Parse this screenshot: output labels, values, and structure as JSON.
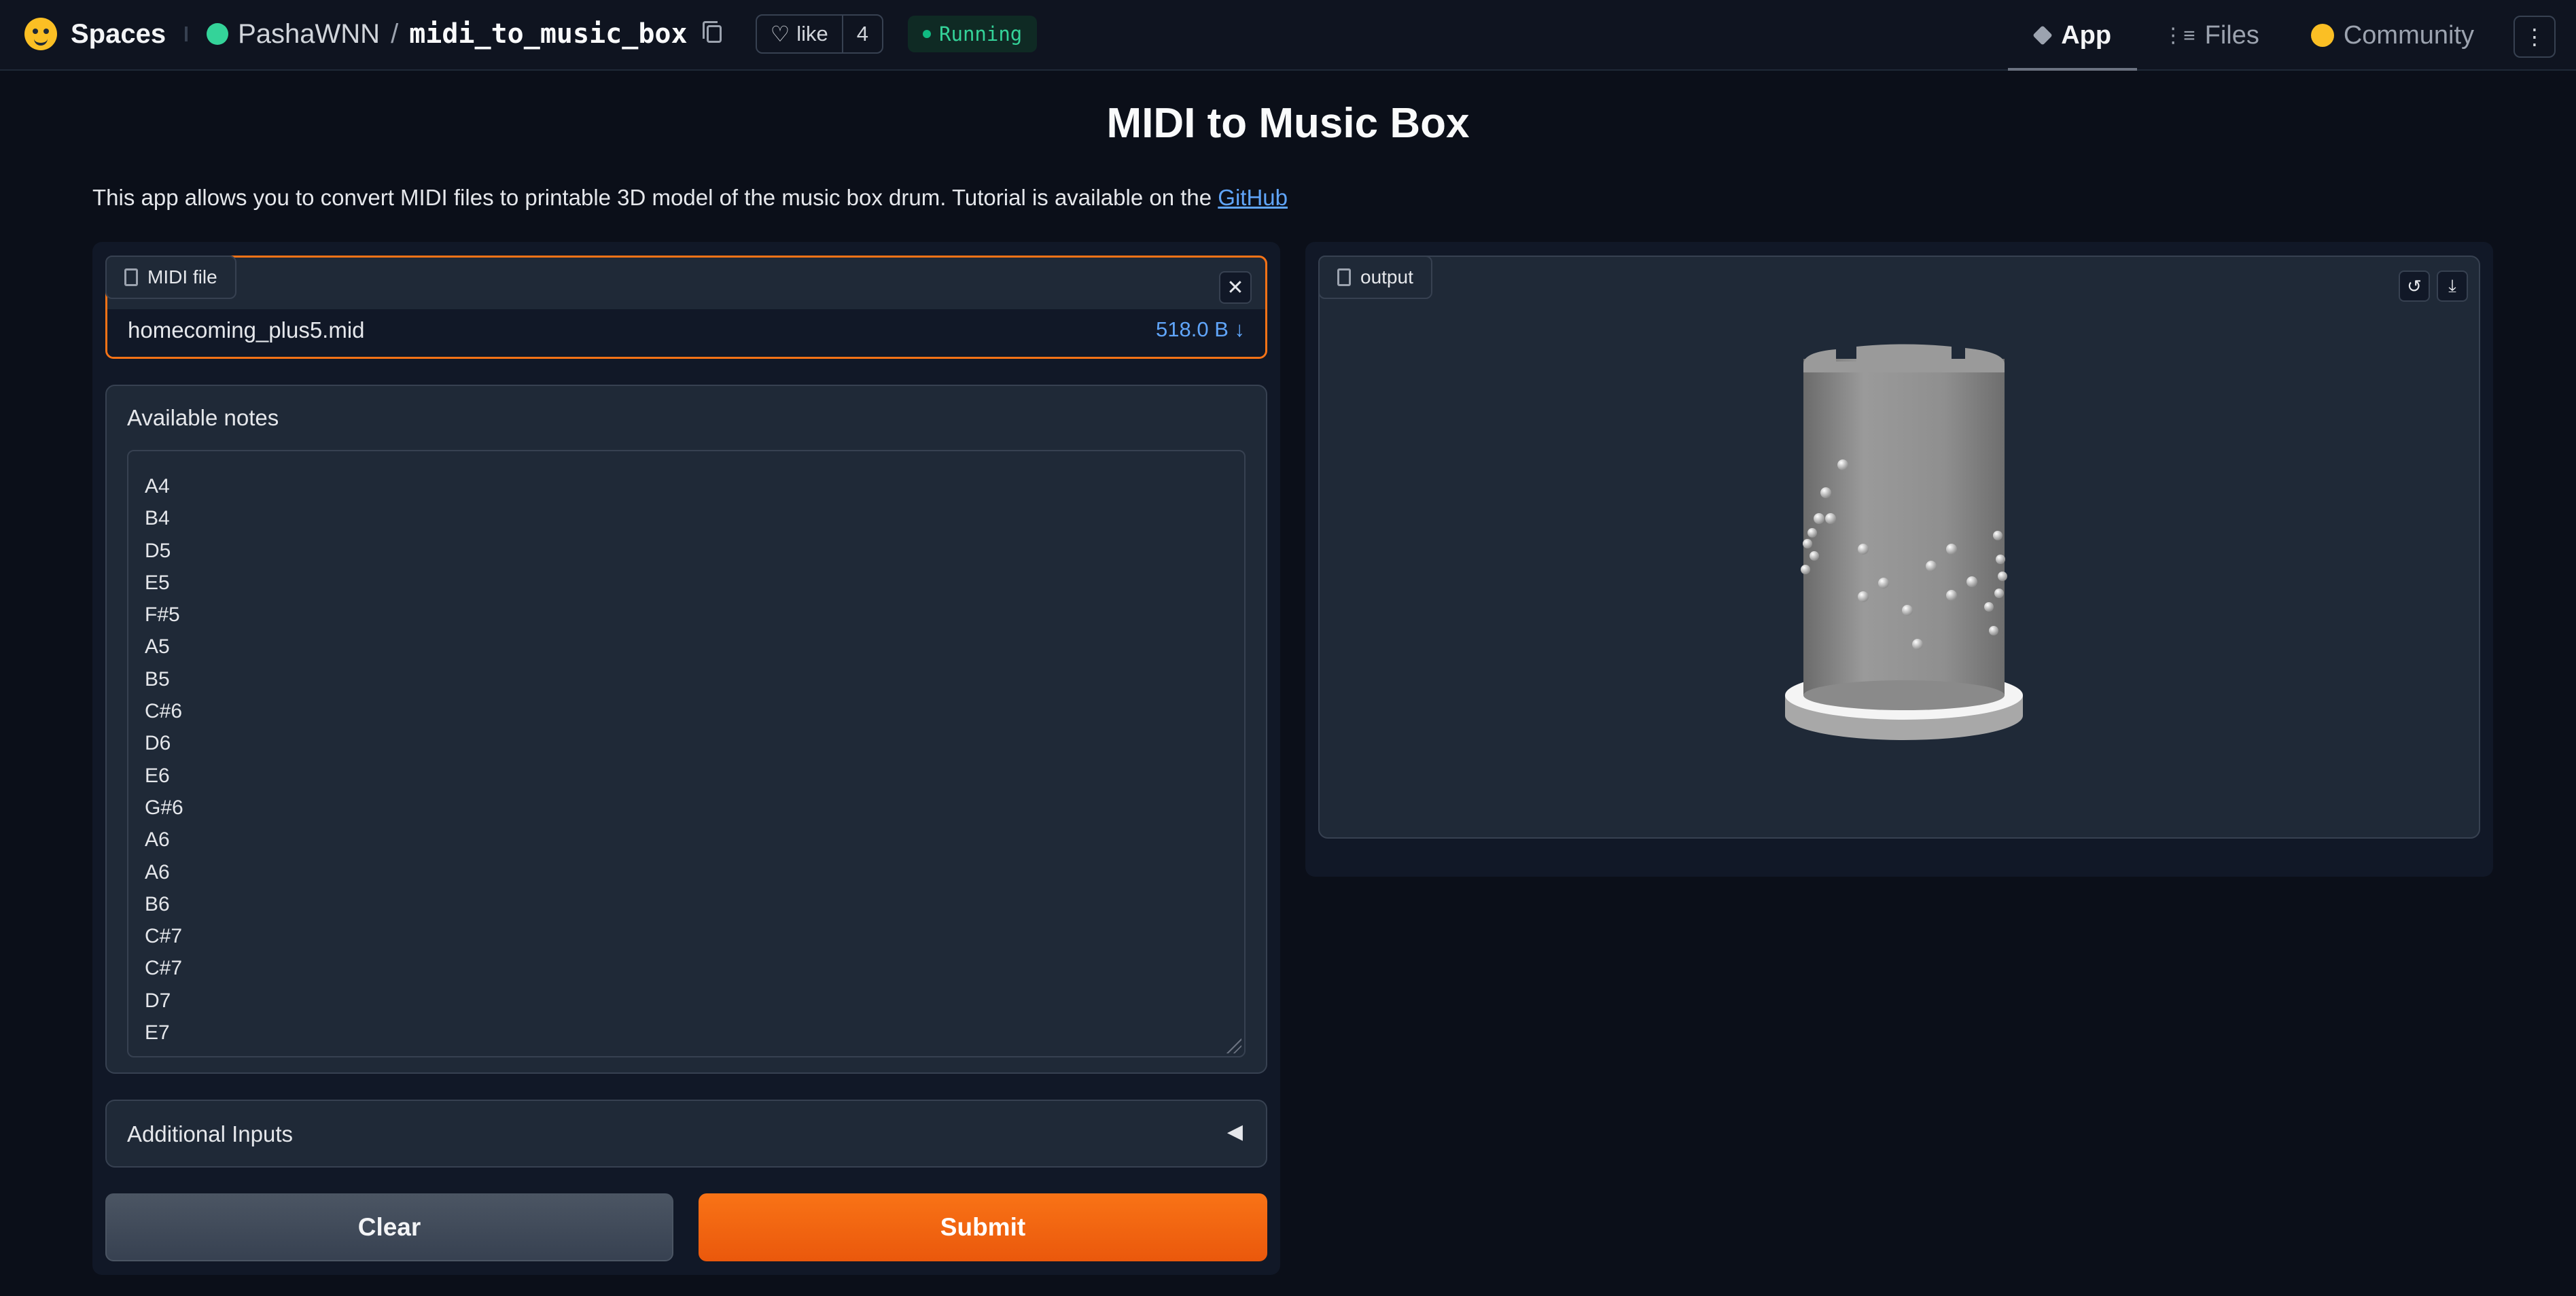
{
  "header": {
    "spaces_label": "Spaces",
    "owner": "PashaWNN",
    "separator": "/",
    "repo": "midi_to_music_box",
    "like_label": "like",
    "like_count": "4",
    "status": "Running",
    "tabs": [
      {
        "label": "App",
        "icon": "cube-icon"
      },
      {
        "label": "Files",
        "icon": "files-icon"
      },
      {
        "label": "Community",
        "icon": "community-icon"
      }
    ],
    "menu_icon": "⋮"
  },
  "page": {
    "title": "MIDI to Music Box",
    "description": "This app allows you to convert MIDI files to printable 3D model of the music box drum. Tutorial is available on the ",
    "link_text": "GitHub"
  },
  "file_input": {
    "label": "MIDI file",
    "file_name": "homecoming_plus5.mid",
    "file_size": "518.0 B ↓",
    "close_glyph": "✕"
  },
  "notes": {
    "label": "Available notes",
    "items": [
      "A4",
      "B4",
      "D5",
      "E5",
      "F#5",
      "A5",
      "B5",
      "C#6",
      "D6",
      "E6",
      "G#6",
      "A6",
      "A6",
      "B6",
      "C#7",
      "C#7",
      "D7",
      "E7"
    ]
  },
  "accordion": {
    "label": "Additional Inputs",
    "arrow": "◀"
  },
  "buttons": {
    "clear": "Clear",
    "submit": "Submit"
  },
  "output": {
    "label": "output",
    "reset_glyph": "↺",
    "download_glyph": "⤓"
  },
  "colors": {
    "accent": "#f97316",
    "background": "#0b0f19",
    "panel": "#1f2937",
    "link": "#60a5fa",
    "running": "#34d399"
  }
}
